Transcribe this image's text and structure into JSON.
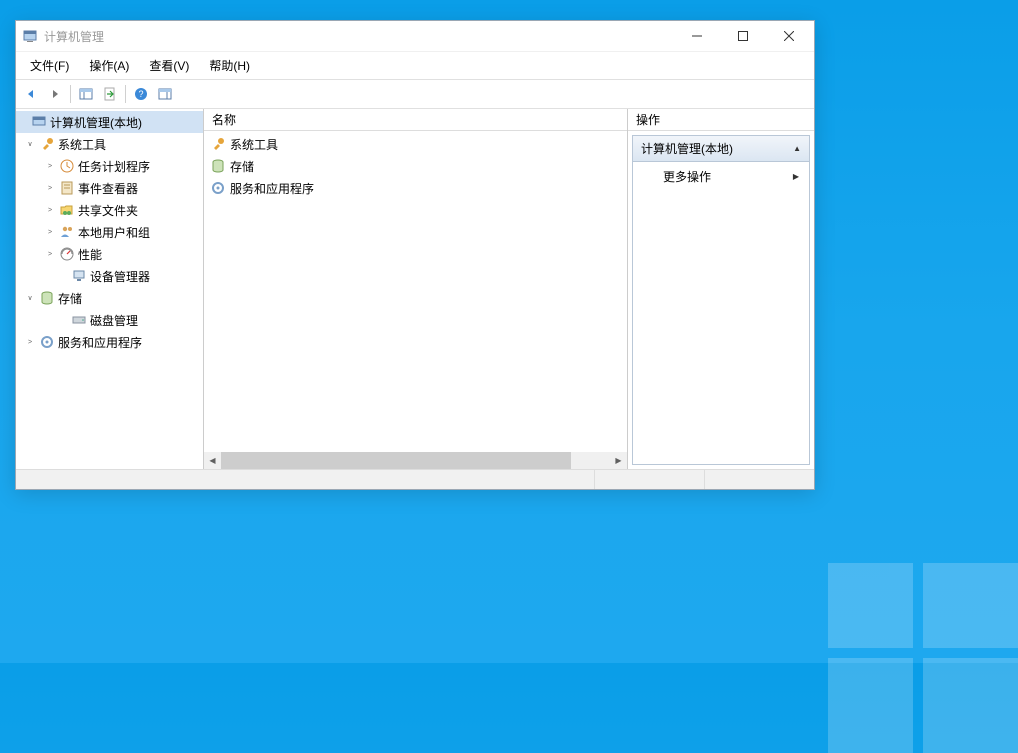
{
  "window": {
    "title": "计算机管理"
  },
  "menubar": {
    "file": "文件(F)",
    "action": "操作(A)",
    "view": "查看(V)",
    "help": "帮助(H)"
  },
  "tree": {
    "root": "计算机管理(本地)",
    "system_tools": "系统工具",
    "task_scheduler": "任务计划程序",
    "event_viewer": "事件查看器",
    "shared_folders": "共享文件夹",
    "local_users": "本地用户和组",
    "performance": "性能",
    "device_manager": "设备管理器",
    "storage": "存储",
    "disk_management": "磁盘管理",
    "services_apps": "服务和应用程序"
  },
  "center": {
    "column_name": "名称",
    "items": {
      "system_tools": "系统工具",
      "storage": "存储",
      "services_apps": "服务和应用程序"
    }
  },
  "actions": {
    "header": "操作",
    "section_title": "计算机管理(本地)",
    "more_actions": "更多操作"
  }
}
